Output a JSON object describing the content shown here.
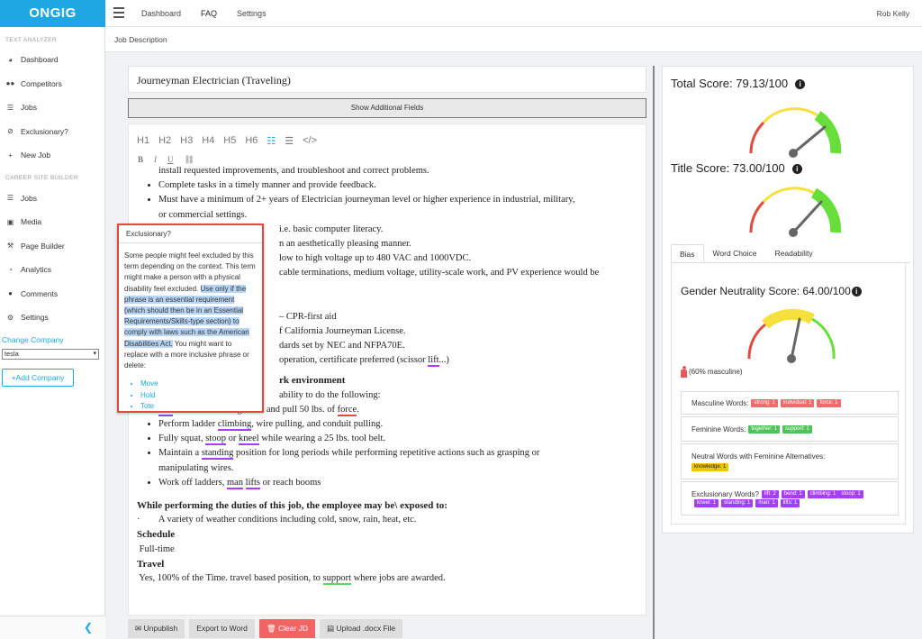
{
  "app": {
    "logo": "ONGIG"
  },
  "topnav": {
    "items": [
      "Dashboard",
      "FAQ",
      "Settings"
    ],
    "user": "Rob Kelly"
  },
  "sidebar": {
    "section1": "TEXT ANALYZER",
    "items1": [
      {
        "label": "Dashboard",
        "icon": "dashboard-icon"
      },
      {
        "label": "Competitors",
        "icon": "users-icon"
      },
      {
        "label": "Jobs",
        "icon": "list-icon"
      },
      {
        "label": "Exclusionary?",
        "icon": "ban-icon"
      },
      {
        "label": "New Job",
        "icon": "plus-icon"
      }
    ],
    "section2": "CAREER SITE BUILDER",
    "items2": [
      {
        "label": "Jobs",
        "icon": "list-icon"
      },
      {
        "label": "Media",
        "icon": "media-icon"
      },
      {
        "label": "Page Builder",
        "icon": "hammer-icon"
      },
      {
        "label": "Analytics",
        "icon": "chart-icon"
      },
      {
        "label": "Comments",
        "icon": "comment-icon"
      },
      {
        "label": "Settings",
        "icon": "gear-icon"
      }
    ],
    "change_company": "Change Company",
    "company_select": "tesla",
    "add_company": "+Add Company"
  },
  "subheader": "Job Description",
  "editor": {
    "title": "Journeyman Electrician (Traveling)",
    "show_fields": "Show Additional Fields",
    "toolbar": [
      "H1",
      "H2",
      "H3",
      "H4",
      "H5",
      "H6"
    ],
    "lines": {
      "l1": "install requested improvements, and troubleshoot and correct problems.",
      "l2": "Complete tasks in a timely manner and provide feedback.",
      "l3": "Must have a minimum of 2+ years of Electrician journeyman level or higher experience in industrial, military,",
      "l3b": "or commercial settings.",
      "l4": "i.e. basic computer literacy.",
      "l5": "n an aesthetically pleasing manner.",
      "l6": "low to high voltage up to 480 VAC and 1000VDC.",
      "l7": "cable terminations, medium voltage, utility-scale work, and PV experience would be",
      "l8": "– CPR-first aid",
      "l9": "f California Journeyman License.",
      "l10": "dards set by NEC and NFPA70E.",
      "l11a": "operation, certificate preferred (scissor ",
      "l11w": "lift",
      "l11b": "...)",
      "h_env": "rk environment",
      "l12": "ability to do the following:",
      "b1": {
        "w1": "Lift",
        "t1": " 50 lbs. from the ground and pull 50 lbs. of ",
        "w2": "force",
        "t2": "."
      },
      "b2": {
        "t1": "Perform ladder ",
        "w1": "climbing",
        "t2": ", wire pulling, and conduit pulling."
      },
      "b3": {
        "t1": "Fully squat, ",
        "w1": "stoop",
        "t2": " or ",
        "w2": "kneel",
        "t3": " while wearing a 25 lbs. tool belt."
      },
      "b4": {
        "t1": "Maintain a ",
        "w1": "standing",
        "t2": " position for long periods while performing repetitive actions such as grasping or"
      },
      "b4b": "manipulating wires.",
      "b5": {
        "t1": "Work off ladders, ",
        "w1": "man",
        "t2": " ",
        "w2": "lifts",
        "t3": " or reach booms"
      },
      "h_exposed": "While performing the duties of this job, the employee may be\\ exposed to:",
      "exposed": "·        A variety of weather conditions including cold, snow, rain, heat, etc.",
      "h_schedule": "Schedule",
      "schedule": " Full-time",
      "h_travel": "Travel",
      "travel_a": " Yes, 100% of the Time. travel based position, to ",
      "travel_w": "support",
      "travel_b": " where jobs are awarded."
    }
  },
  "popup": {
    "title": "Exclusionary?",
    "text1": "Some people might feel excluded by this term depending on the context. This term might make a person with a physical disability feel excluded.",
    "text_hl": "Use only if the phrase is an essential requirement (which should then be in an Essential Requirements/Skills-type section) to comply with laws such as the American Disabilities Act.",
    "text2": " You might want to replace with a more inclusive phrase or delete:",
    "options": [
      "Move",
      "Hold",
      "Tote"
    ]
  },
  "buttons": {
    "unpublish": "Unpublish",
    "export": "Export to Word",
    "clear": "Clear JD",
    "upload": "Upload .docx File"
  },
  "scores": {
    "total": "Total Score: 79.13/100",
    "title": "Title Score: 73.00/100",
    "tabs": [
      "Bias",
      "Word Choice",
      "Readability"
    ],
    "gender": "Gender Neutrality Score: 64.00/100",
    "masculine_pct": "(60% masculine)",
    "total_value": 79.13,
    "title_value": 73.0,
    "gender_value": 64.0
  },
  "word_lists": {
    "masculine": {
      "label": "Masculine Words:",
      "tags": [
        "strong: 1",
        "individual: 1",
        "force: 1"
      ]
    },
    "feminine": {
      "label": "Feminine Words:",
      "tags": [
        "together: 1",
        "support: 1"
      ]
    },
    "neutral": {
      "label": "Neutral Words with Feminine Alternatives:",
      "tags": [
        "knowledge: 1"
      ]
    },
    "exclusionary": {
      "label": "Exclusionary Words?",
      "tags": [
        "lift: 2",
        "bend: 1",
        "climbing: 1",
        "stoop: 1",
        "kneel: 1",
        "standing: 1",
        "man: 1",
        "lifts: 1"
      ]
    }
  },
  "colors": {
    "brand": "#1ea7e1",
    "danger": "#e8453c",
    "purple": "#a43ff3",
    "green": "#4fc35a",
    "red": "#f06b6b"
  }
}
